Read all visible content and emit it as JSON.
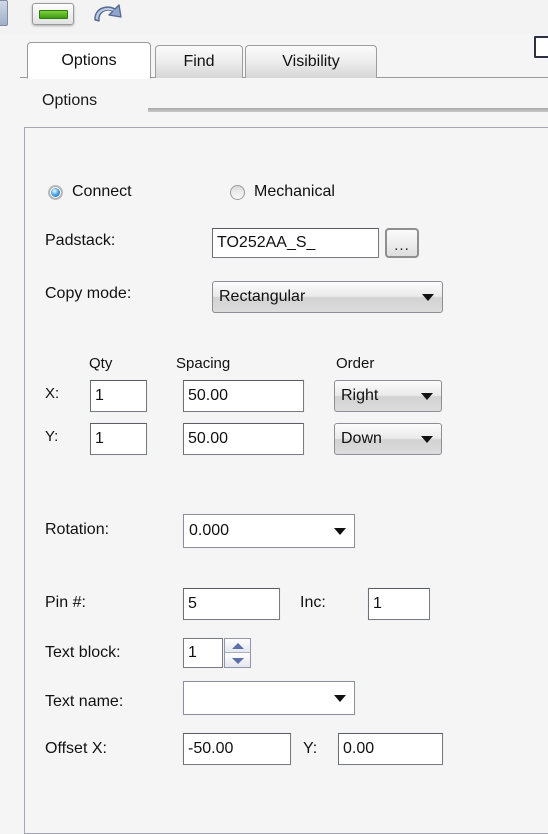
{
  "toolbar": {
    "icons": [
      {
        "name": "partial-icon",
        "label": ""
      },
      {
        "name": "green-bar-icon",
        "label": ""
      },
      {
        "name": "undo-arrow-icon",
        "label": ""
      }
    ]
  },
  "tabs": [
    {
      "label": "Options",
      "active": true
    },
    {
      "label": "Find",
      "active": false
    },
    {
      "label": "Visibility",
      "active": false
    }
  ],
  "group": {
    "title": "Options"
  },
  "form": {
    "mode": {
      "connect_label": "Connect",
      "connect_selected": true,
      "mechanical_label": "Mechanical",
      "mechanical_selected": false
    },
    "padstack": {
      "label": "Padstack:",
      "value": "TO252AA_S_",
      "browse_label": "..."
    },
    "copy_mode": {
      "label": "Copy mode:",
      "value": "Rectangular"
    },
    "grid": {
      "headers": {
        "qty": "Qty",
        "spacing": "Spacing",
        "order": "Order"
      },
      "rows": [
        {
          "axis": "X:",
          "qty": "1",
          "spacing": "50.00",
          "order": "Right"
        },
        {
          "axis": "Y:",
          "qty": "1",
          "spacing": "50.00",
          "order": "Down"
        }
      ]
    },
    "rotation": {
      "label": "Rotation:",
      "value": "0.000"
    },
    "pin": {
      "label": "Pin #:",
      "value": "5",
      "inc_label": "Inc:",
      "inc_value": "1"
    },
    "text_block": {
      "label": "Text block:",
      "value": "1"
    },
    "text_name": {
      "label": "Text name:",
      "value": ""
    },
    "offset": {
      "x_label": "Offset X:",
      "x_value": "-50.00",
      "y_label": "Y:",
      "y_value": "0.00"
    }
  },
  "colors": {
    "accent": "#1463a8",
    "panel_bg": "#f5f5f5",
    "spinner_arrow": "#5b6fa8"
  }
}
